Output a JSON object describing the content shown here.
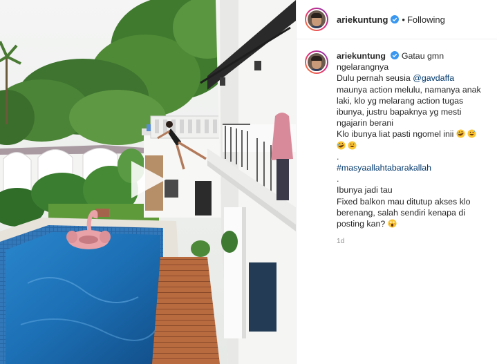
{
  "post": {
    "username": "ariekuntung",
    "follow_separator": "•",
    "follow_status": "Following",
    "caption": {
      "username": "ariekuntung",
      "lines": [
        "Gatau gmn ngelarangnya",
        "Dulu pernah seusia",
        "maunya action melulu, namanya anak laki, klo yg melarang action tugas ibunya, justru bapaknya yg mesti ngajarin berani",
        "Klo ibunya liat pasti ngomel inii",
        ".",
        ".",
        "Ibunya jadi tau",
        "Fixed balkon mau ditutup akses klo berenang, salah sendiri kenapa di posting kan?"
      ],
      "mention": "@gavdaffa",
      "hashtag": "#masyaallahtabarakallah"
    },
    "timestamp": "1d",
    "emojis": {
      "rofl": "rolling-on-floor-laughing",
      "sweat_smile": "grinning-face-with-sweat",
      "scream": "face-screaming-in-fear"
    }
  },
  "media": {
    "type": "video",
    "play_icon": "play-icon"
  },
  "colors": {
    "link": "#00376b",
    "verified": "#3897f0",
    "pool_water": "#1f72b8",
    "deck_wood": "#b86a3e"
  }
}
